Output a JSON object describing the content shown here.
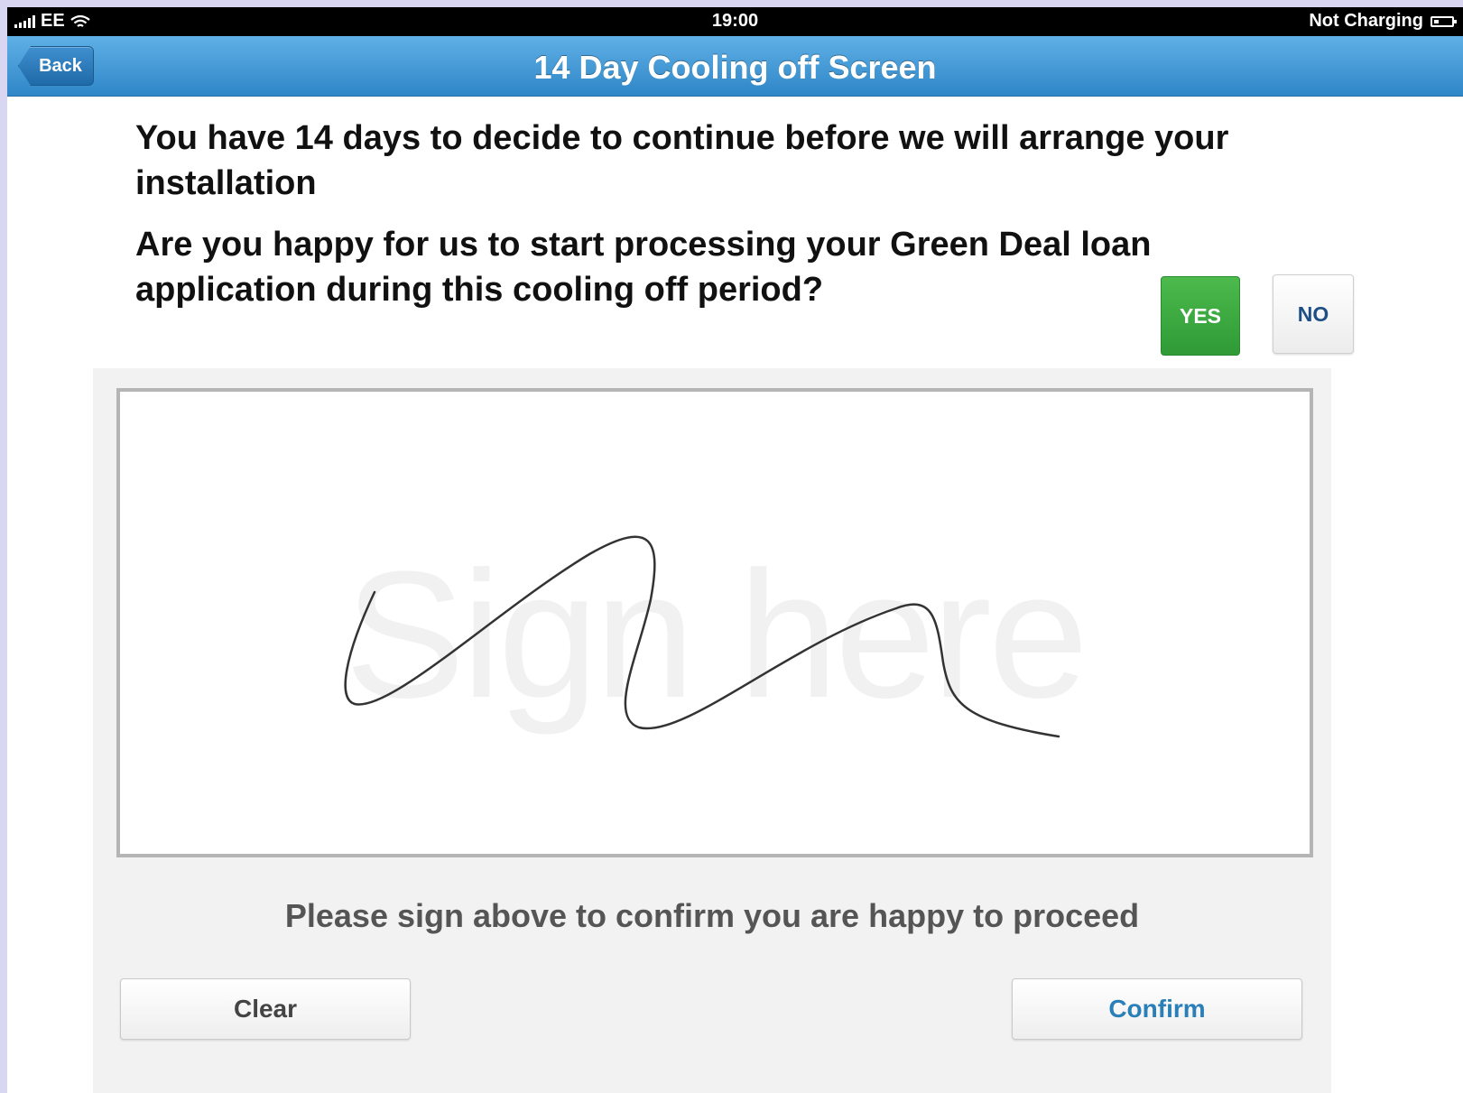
{
  "status_bar": {
    "carrier": "EE",
    "time": "19:00",
    "charging": "Not Charging"
  },
  "nav": {
    "back_label": "Back",
    "title": "14 Day Cooling off Screen"
  },
  "content": {
    "info_text": "You have 14 days to decide to continue before we will arrange your installation",
    "question_text": "Are you happy for us to start processing your Green Deal loan application during this cooling off period?",
    "yes_label": "YES",
    "no_label": "NO"
  },
  "signature": {
    "placeholder": "Sign here",
    "instruction": "Please sign above to confirm you are happy to proceed"
  },
  "actions": {
    "clear_label": "Clear",
    "confirm_label": "Confirm"
  },
  "colors": {
    "nav_blue": "#2f86c7",
    "yes_green": "#3aa83f",
    "confirm_text": "#2a7fb8"
  }
}
